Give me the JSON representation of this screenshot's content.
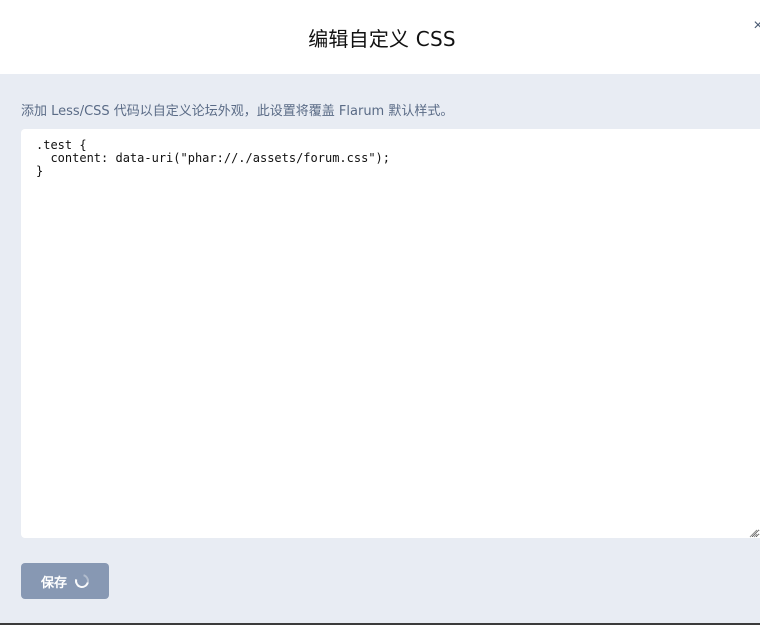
{
  "modal": {
    "title": "编辑自定义 CSS",
    "close_icon": "close-icon",
    "close_glyph": "×"
  },
  "body": {
    "helptext": "添加 Less/CSS 代码以自定义论坛外观，此设置将覆盖 Flarum 默认样式。",
    "editor_value": ".test {\n  content: data-uri(\"phar://./assets/forum.css\");\n}",
    "save_label": "保存",
    "save_state": "loading"
  },
  "colors": {
    "body_background": "#e8ecf3",
    "helptext": "#5a6b86",
    "button_background": "#8798b3",
    "close_icon": "#4a5a73"
  }
}
